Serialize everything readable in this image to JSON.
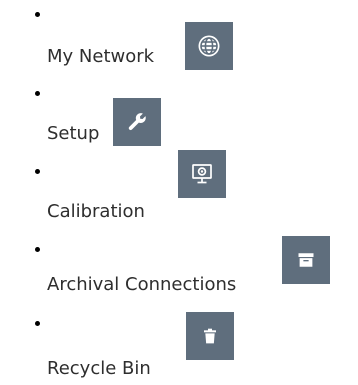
{
  "nav": {
    "items": [
      {
        "label": "My Network",
        "icon": "globe-icon"
      },
      {
        "label": "Setup",
        "icon": "wrench-icon"
      },
      {
        "label": "Calibration",
        "icon": "monitor-target-icon"
      },
      {
        "label": "Archival Connections",
        "icon": "archive-box-icon"
      },
      {
        "label": "Recycle Bin",
        "icon": "trash-icon"
      }
    ]
  },
  "colors": {
    "icon_button_bg": "#5f6e7d",
    "icon_fg": "#ffffff",
    "text": "#2e2e2e",
    "bullet": "#000000"
  }
}
